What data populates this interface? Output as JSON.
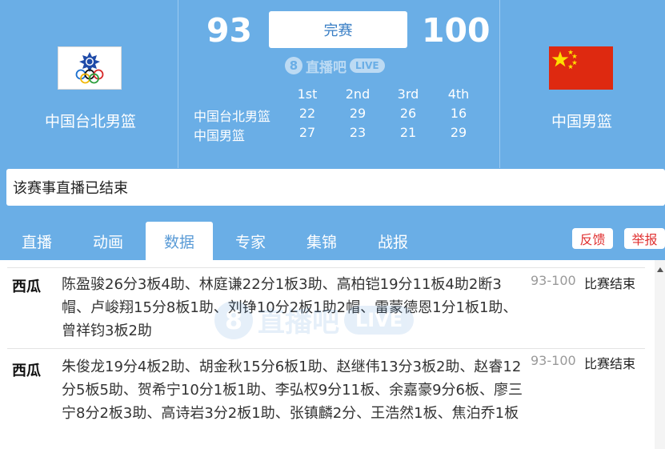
{
  "match": {
    "home_team": "中国台北男篮",
    "away_team": "中国男篮",
    "home_score": "93",
    "away_score": "100",
    "status": "完赛"
  },
  "logo": {
    "mark": "8",
    "brand": "直播吧",
    "live": "LIVE"
  },
  "quarters": {
    "headers": [
      "1st",
      "2nd",
      "3rd",
      "4th"
    ],
    "rows": [
      {
        "team": "中国台北男篮",
        "scores": [
          "22",
          "29",
          "26",
          "16"
        ]
      },
      {
        "team": "中国男篮",
        "scores": [
          "27",
          "23",
          "21",
          "29"
        ]
      }
    ]
  },
  "live_notice": "该赛事直播已结束",
  "tabs": [
    "直播",
    "动画",
    "数据",
    "专家",
    "集锦",
    "战报"
  ],
  "active_tab": "数据",
  "actions": {
    "feedback": "反馈",
    "report": "举报"
  },
  "posts": [
    {
      "source": "西瓜",
      "text": "陈盈骏26分3板4助、林庭谦22分1板3助、高柏铠19分11板4助2断3帽、卢峻翔15分8板1助、刘铮10分2板1助2帽、雷蒙德恩1分1板1助、曾祥钧3板2助",
      "score": "93-100",
      "status": "比赛结束"
    },
    {
      "source": "西瓜",
      "text": "朱俊龙19分4板2助、胡金秋15分6板1助、赵继伟13分3板2助、赵睿12分5板5助、贺希宁10分1板1助、李弘权9分11板、余嘉豪9分6板、廖三宁8分2板3助、高诗岩3分2板1助、张镇麟2分、王浩然1板、焦泊乔1板",
      "score": "93-100",
      "status": "比赛结束"
    }
  ],
  "colors": {
    "header_bg": "#6aaee6",
    "accent_red": "#e03030",
    "flag_red": "#de2910",
    "flag_yellow": "#ffde00"
  }
}
